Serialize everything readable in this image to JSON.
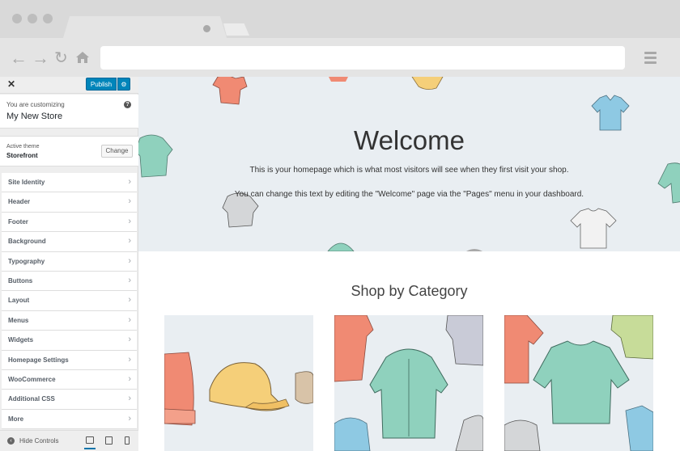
{
  "browser": {
    "back_icon": "back-arrow-icon",
    "forward_icon": "forward-arrow-icon",
    "reload_icon": "reload-icon",
    "home_icon": "home-icon",
    "menu_icon": "hamburger-menu-icon",
    "address": ""
  },
  "customizer": {
    "close_label": "✕",
    "publish_label": "Publish",
    "settings_icon": "gear-icon",
    "customizing_label": "You are customizing",
    "store_name": "My New Store",
    "help_label": "?",
    "active_theme_label": "Active theme",
    "active_theme_name": "Storefront",
    "change_label": "Change",
    "sections": [
      {
        "label": "Site Identity"
      },
      {
        "label": "Header"
      },
      {
        "label": "Footer"
      },
      {
        "label": "Background"
      },
      {
        "label": "Typography"
      },
      {
        "label": "Buttons"
      },
      {
        "label": "Layout"
      },
      {
        "label": "Menus"
      },
      {
        "label": "Widgets"
      },
      {
        "label": "Homepage Settings"
      },
      {
        "label": "WooCommerce"
      },
      {
        "label": "Additional CSS"
      },
      {
        "label": "More"
      }
    ],
    "hide_controls_label": "Hide Controls",
    "devices": [
      "desktop",
      "tablet",
      "mobile"
    ],
    "active_device": "desktop"
  },
  "preview": {
    "welcome_title": "Welcome",
    "welcome_line1": "This is your homepage which is what most visitors will see when they first visit your shop.",
    "welcome_line2": "You can change this text by editing the \"Welcome\" page via the \"Pages\" menu in your dashboard.",
    "section_title": "Shop by Category",
    "categories": [
      {
        "name": "accessories-category-image"
      },
      {
        "name": "hoodies-category-image"
      },
      {
        "name": "tshirts-category-image"
      }
    ]
  },
  "colors": {
    "accent": "#0085ba",
    "hero_bg": "#e9eef2",
    "sidebar_bg": "#eeeeee"
  }
}
